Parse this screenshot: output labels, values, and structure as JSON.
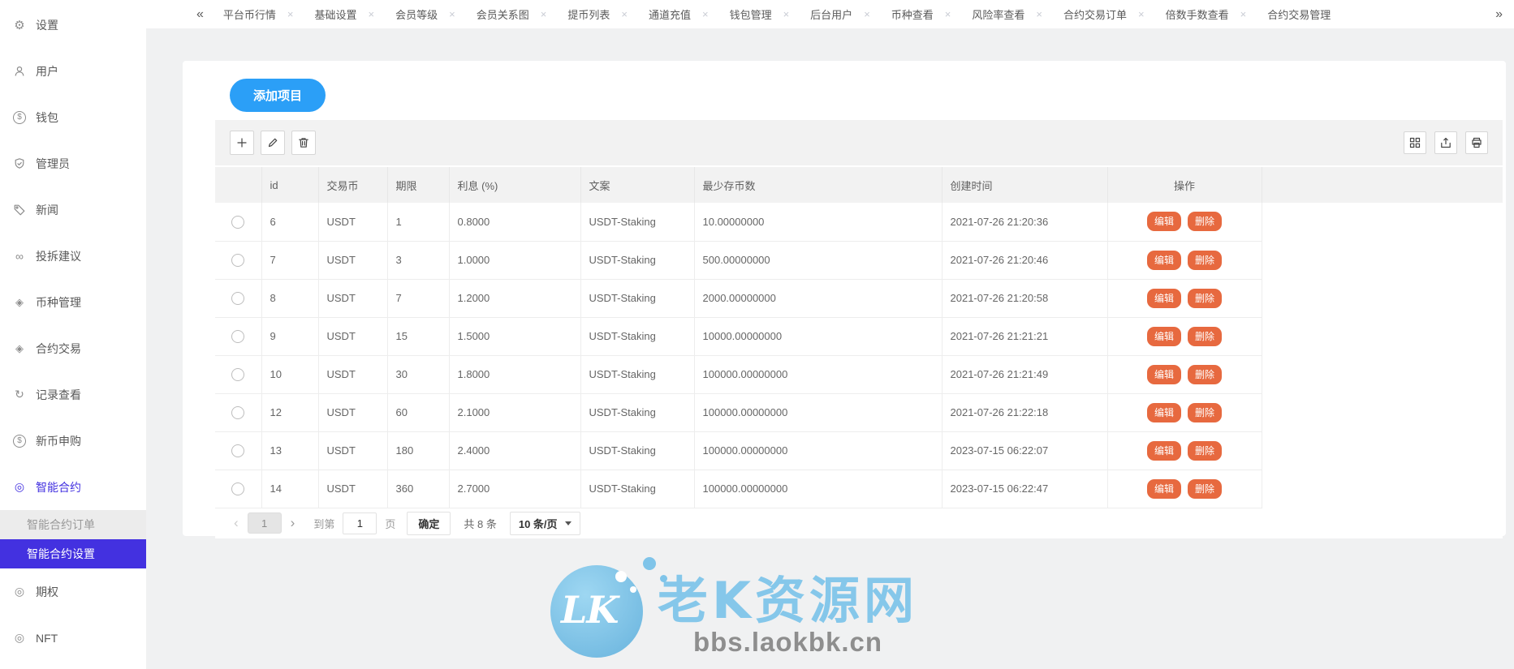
{
  "colors": {
    "accent_blue": "#2B9FF7",
    "active_menu": "#4331E0",
    "action_orange": "#E7693F",
    "watermark_blue": "#85C7EA"
  },
  "sidebar": {
    "items": [
      {
        "label": "设置",
        "icon": "gear-icon"
      },
      {
        "label": "用户",
        "icon": "user-icon"
      },
      {
        "label": "钱包",
        "icon": "wallet-icon"
      },
      {
        "label": "管理员",
        "icon": "shield-icon"
      },
      {
        "label": "新闻",
        "icon": "tag-icon"
      },
      {
        "label": "投拆建议",
        "icon": "link-icon"
      },
      {
        "label": "币种管理",
        "icon": "gem-icon"
      },
      {
        "label": "合约交易",
        "icon": "gem-icon"
      },
      {
        "label": "记录查看",
        "icon": "history-icon"
      },
      {
        "label": "新币申购",
        "icon": "coin-icon"
      },
      {
        "label": "智能合约",
        "icon": "target-icon",
        "highlighted": true
      },
      {
        "label": "智能合约订单",
        "submenu": true
      },
      {
        "label": "智能合约设置",
        "submenu": true,
        "active": true
      },
      {
        "label": "期权",
        "icon": "target-icon"
      },
      {
        "label": "NFT",
        "icon": "target-icon"
      }
    ]
  },
  "tabbar": {
    "collapse_icon": "«",
    "expand_icon": "»",
    "close_icon": "×",
    "tabs": [
      {
        "label": "平台币行情",
        "closable": true
      },
      {
        "label": "基础设置",
        "closable": true
      },
      {
        "label": "会员等级",
        "closable": true
      },
      {
        "label": "会员关系图",
        "closable": true
      },
      {
        "label": "提币列表",
        "closable": true
      },
      {
        "label": "通道充值",
        "closable": true
      },
      {
        "label": "钱包管理",
        "closable": true
      },
      {
        "label": "后台用户",
        "closable": true
      },
      {
        "label": "币种查看",
        "closable": true
      },
      {
        "label": "风险率查看",
        "closable": true
      },
      {
        "label": "合约交易订单",
        "closable": true
      },
      {
        "label": "倍数手数查看",
        "closable": true
      },
      {
        "label": "合约交易管理",
        "closable": false
      }
    ]
  },
  "toolbar": {
    "add_button": "添加项目",
    "left_icons": [
      "plus-icon",
      "edit-icon",
      "trash-icon"
    ],
    "right_icons": [
      "columns-icon",
      "export-icon",
      "print-icon"
    ]
  },
  "table": {
    "headers": [
      "id",
      "交易币",
      "期限",
      "利息 (%)",
      "文案",
      "最少存币数",
      "创建时间",
      "操作"
    ],
    "edit_label": "编辑",
    "delete_label": "删除",
    "rows": [
      {
        "id": "6",
        "coin": "USDT",
        "term": "1",
        "interest": "0.8000",
        "text": "USDT-Staking",
        "min_deposit": "10.00000000",
        "created": "2021-07-26 21:20:36"
      },
      {
        "id": "7",
        "coin": "USDT",
        "term": "3",
        "interest": "1.0000",
        "text": "USDT-Staking",
        "min_deposit": "500.00000000",
        "created": "2021-07-26 21:20:46"
      },
      {
        "id": "8",
        "coin": "USDT",
        "term": "7",
        "interest": "1.2000",
        "text": "USDT-Staking",
        "min_deposit": "2000.00000000",
        "created": "2021-07-26 21:20:58"
      },
      {
        "id": "9",
        "coin": "USDT",
        "term": "15",
        "interest": "1.5000",
        "text": "USDT-Staking",
        "min_deposit": "10000.00000000",
        "created": "2021-07-26 21:21:21"
      },
      {
        "id": "10",
        "coin": "USDT",
        "term": "30",
        "interest": "1.8000",
        "text": "USDT-Staking",
        "min_deposit": "100000.00000000",
        "created": "2021-07-26 21:21:49"
      },
      {
        "id": "12",
        "coin": "USDT",
        "term": "60",
        "interest": "2.1000",
        "text": "USDT-Staking",
        "min_deposit": "100000.00000000",
        "created": "2021-07-26 21:22:18"
      },
      {
        "id": "13",
        "coin": "USDT",
        "term": "180",
        "interest": "2.4000",
        "text": "USDT-Staking",
        "min_deposit": "100000.00000000",
        "created": "2023-07-15 06:22:07"
      },
      {
        "id": "14",
        "coin": "USDT",
        "term": "360",
        "interest": "2.7000",
        "text": "USDT-Staking",
        "min_deposit": "100000.00000000",
        "created": "2023-07-15 06:22:47"
      }
    ]
  },
  "pagination": {
    "prev_icon": "‹",
    "next_icon": "›",
    "current_page": "1",
    "goto_label": "到第",
    "goto_value": "1",
    "page_unit": "页",
    "confirm_label": "确定",
    "total_text": "共 8 条",
    "page_size": "10 条/页"
  },
  "watermark": {
    "logo_text": "LK",
    "site_name": "老K资源网",
    "site_url": "bbs.laokbk.cn"
  }
}
